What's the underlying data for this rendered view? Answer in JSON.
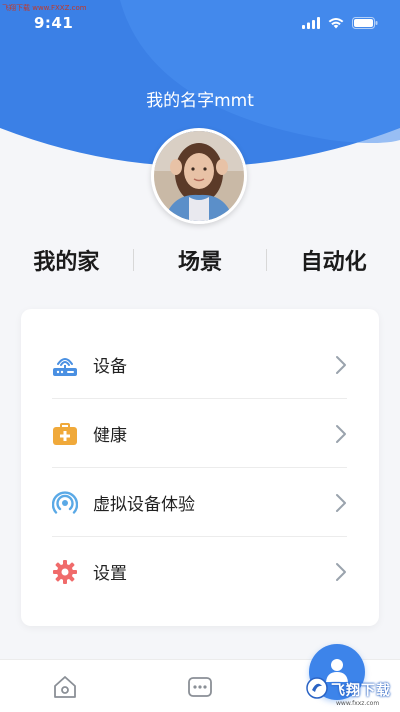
{
  "watermark": {
    "top_left": "飞翔下载 www.FXXZ.com",
    "bottom_badge": "飞翔下载",
    "bottom_url": "www.fxxz.com"
  },
  "status_bar": {
    "time": "9:41",
    "icons": [
      "signal-icon",
      "wifi-icon",
      "battery-icon"
    ]
  },
  "profile": {
    "name": "我的名字mmt"
  },
  "tabs": [
    {
      "label": "我的家"
    },
    {
      "label": "场景"
    },
    {
      "label": "自动化"
    }
  ],
  "menu": {
    "items": [
      {
        "label": "设备",
        "icon": "router-icon",
        "color": "#4a90e2"
      },
      {
        "label": "健康",
        "icon": "medical-kit-icon",
        "color": "#f0a93a"
      },
      {
        "label": "虚拟设备体验",
        "icon": "broadcast-icon",
        "color": "#5aa9e6"
      },
      {
        "label": "设置",
        "icon": "gear-icon",
        "color": "#f06b6b"
      }
    ]
  },
  "bottom_nav": {
    "items": [
      "home-icon",
      "message-icon",
      "profile-icon"
    ]
  },
  "colors": {
    "primary": "#3d84ea",
    "background": "#f5f6f9"
  }
}
